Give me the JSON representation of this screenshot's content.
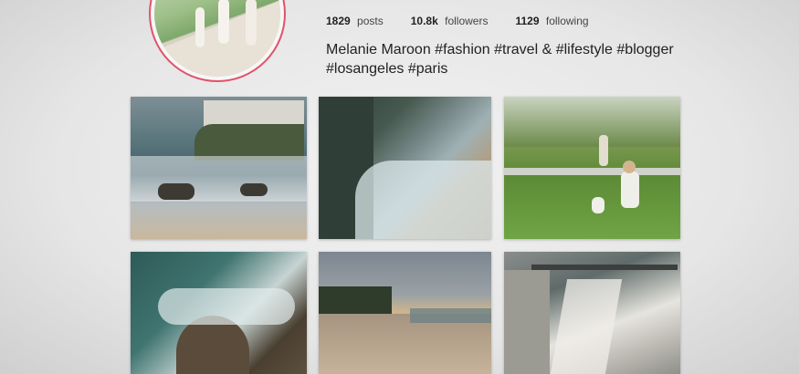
{
  "profile": {
    "stats": {
      "posts": {
        "value": "1829",
        "label": "posts"
      },
      "followers": {
        "value": "10.8k",
        "label": "followers"
      },
      "following": {
        "value": "1129",
        "label": "following"
      }
    },
    "bio_line1": "Melanie Maroon #fashion #travel & #lifestyle #blogger",
    "bio_line2": "#losangeles #paris"
  },
  "colors": {
    "avatar_ring": "#e0536a",
    "text": "#222222"
  },
  "grid": {
    "tiles": [
      "coastal cliff",
      "aerial waves",
      "child in park",
      "aerial surf",
      "beach palms",
      "pier and waves"
    ]
  }
}
